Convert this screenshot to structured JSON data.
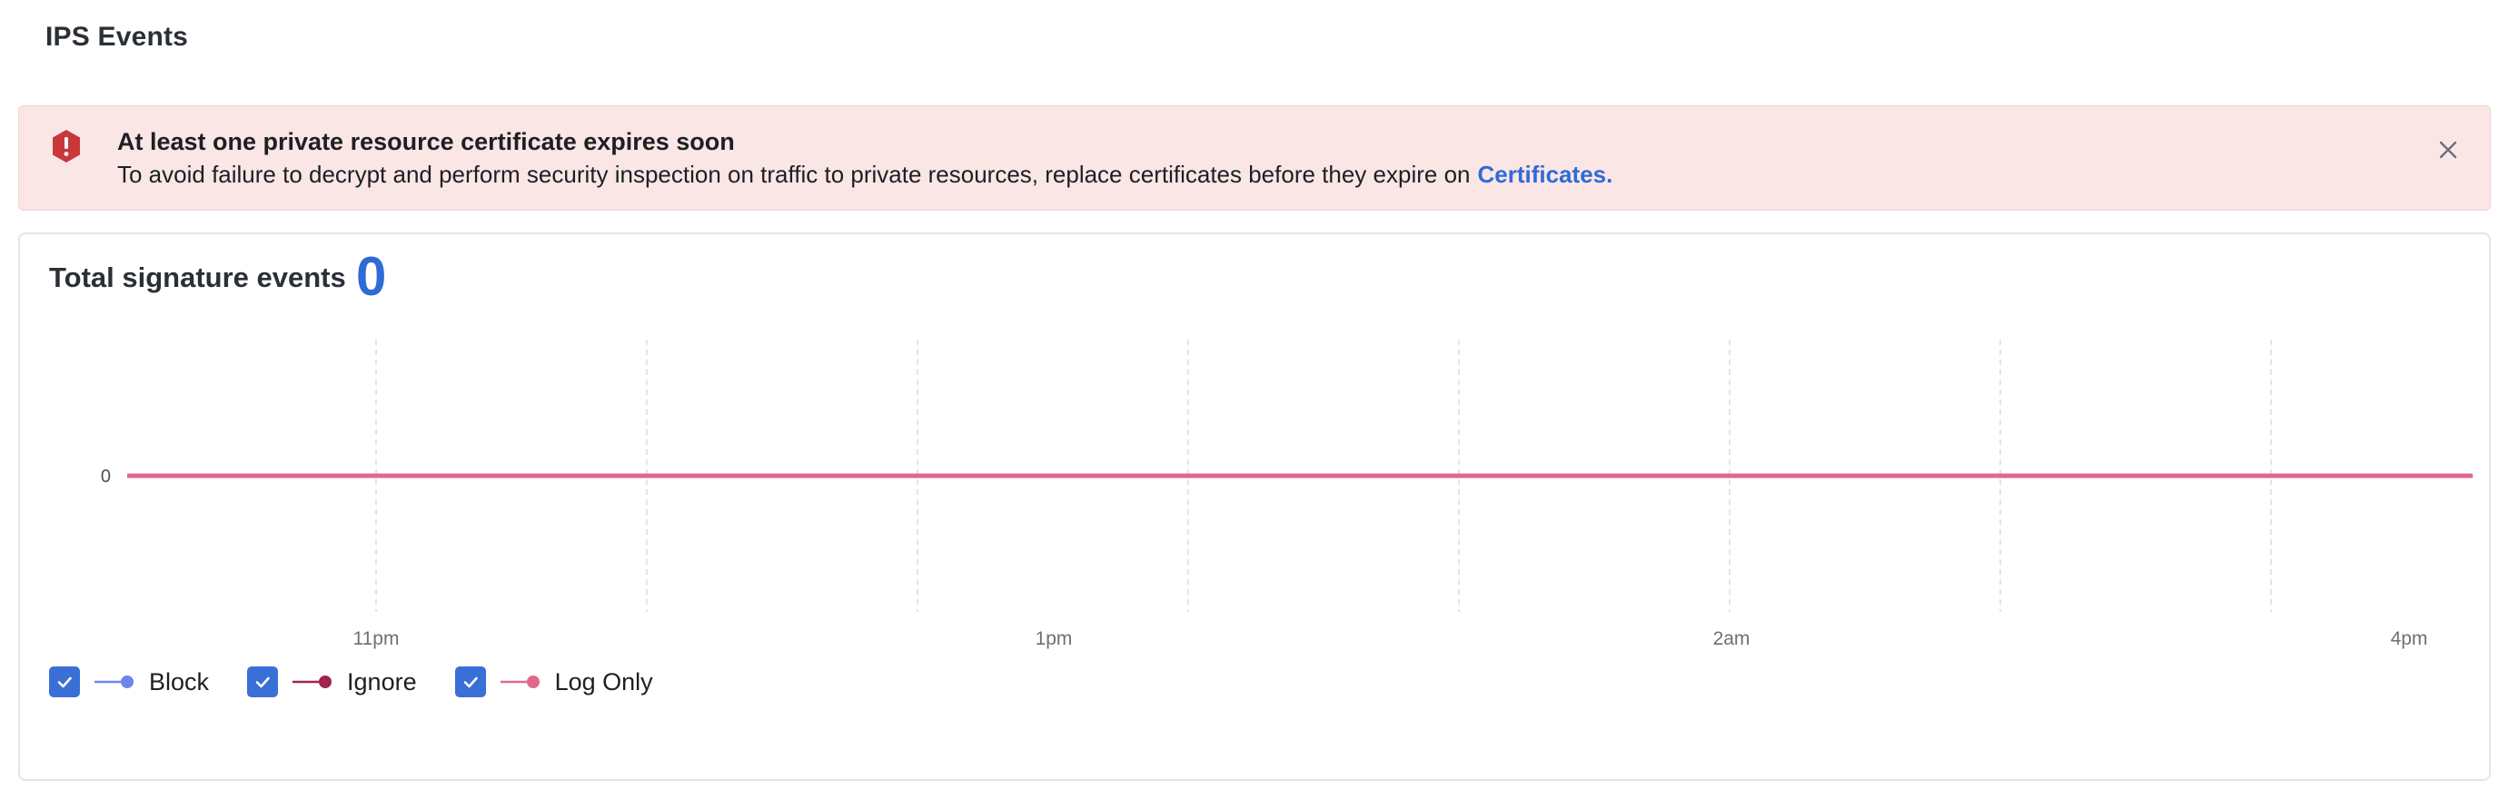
{
  "page": {
    "title": "IPS Events"
  },
  "alert": {
    "title": "At least one private resource certificate expires soon",
    "body": "To avoid failure to decrypt and perform security inspection on traffic to private resources, replace certificates before they expire on",
    "link_label": "Certificates.",
    "icon": "error-shield-icon",
    "close_icon": "close-icon",
    "colors": {
      "background": "#fbe6e6",
      "icon": "#c8383b",
      "link": "#2f6bd6"
    }
  },
  "card": {
    "title": "Total signature events",
    "total": "0"
  },
  "chart_data": {
    "type": "line",
    "x_tick_labels": [
      "11pm",
      "1pm",
      "2am",
      "4pm"
    ],
    "y_tick_labels": [
      "0"
    ],
    "grid": "vertical dashed",
    "series": [
      {
        "name": "Block",
        "color": "#6f86e8",
        "values": [
          0,
          0
        ]
      },
      {
        "name": "Ignore",
        "color": "#a3224f",
        "values": [
          0,
          0
        ]
      },
      {
        "name": "Log Only",
        "color": "#e0688a",
        "values": [
          0,
          0
        ]
      }
    ],
    "legend_placement": "bottom-left"
  },
  "legend": {
    "items": [
      {
        "label": "Block",
        "checked": true,
        "color": "#6f86e8"
      },
      {
        "label": "Ignore",
        "checked": true,
        "color": "#a3224f"
      },
      {
        "label": "Log Only",
        "checked": true,
        "color": "#e0688a"
      }
    ]
  }
}
